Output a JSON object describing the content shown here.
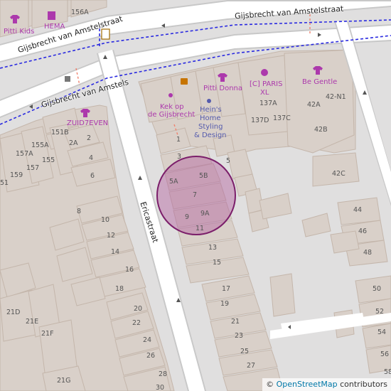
{
  "map": {
    "streets": {
      "gijsbrecht_top_right": "Gijsbrecht van Amstelstraat",
      "gijsbrecht_top_left": "Gijsbrecht van Amstelstraat",
      "gijsbrecht_lower": "Gijsbrecht van Amstels",
      "ericastraat": "Ericastraat"
    },
    "pois": {
      "pitti_kids": "Pitti Kids",
      "hema": "HEMA",
      "zuid7even": "ZUID7EVEN",
      "kek_op_de_gijsbrecht_1": "Kek op",
      "kek_op_de_gijsbrecht_2": "de Gijsbrecht",
      "pitti_donna": "Pitti Donna",
      "heins_1": "Hein's",
      "heins_2": "Home",
      "heins_3": "Styling",
      "heins_4": "& Design",
      "c_paris_1": "[C] PARIS",
      "c_paris_2": "XL",
      "be_gentle": "Be Gentle"
    },
    "house_numbers": {
      "n156A": "156A",
      "n151B": "151B",
      "n2A": "2A",
      "n2": "2",
      "n157A": "157A",
      "n155A": "155A",
      "n159": "159",
      "n157": "157",
      "n155": "155",
      "n4": "4",
      "n6": "6",
      "n51": "51",
      "n1": "1",
      "n3": "3",
      "n5": "5",
      "n5A": "5A",
      "n5B": "5B",
      "n7": "7",
      "n9": "9",
      "n9A": "9A",
      "n11": "11",
      "n13": "13",
      "n15": "15",
      "n17": "17",
      "n19": "19",
      "n21": "21",
      "n23": "23",
      "n25": "25",
      "n27": "27",
      "n8": "8",
      "n10": "10",
      "n12": "12",
      "n14": "14",
      "n16": "16",
      "n18": "18",
      "n20": "20",
      "n22": "22",
      "n24": "24",
      "n26": "26",
      "n28": "28",
      "n30": "30",
      "n21D": "21D",
      "n21E": "21E",
      "n21F": "21F",
      "n21G": "21G",
      "n137A": "137A",
      "n137D": "137D",
      "n137C": "137C",
      "n42A": "42A",
      "n42N1": "42-N1",
      "n42B": "42B",
      "n42C": "42C",
      "n44": "44",
      "n46": "46",
      "n48": "48",
      "n50": "50",
      "n52": "52",
      "n54": "54",
      "n56": "56",
      "n58": "58"
    },
    "colors": {
      "background": "#e0dfdf",
      "building": "#d9d0c9",
      "building_outline": "#c4b6ab",
      "road": "#ffffff",
      "road_casing": "#c8c8c8",
      "bus_route": "#2a2ae0",
      "poi_magenta": "#ac39ac",
      "cafe_orange": "#c77400",
      "marker_fill": "#b4629f",
      "marker_stroke": "#7b1e6a"
    },
    "attribution": {
      "symbol": "©",
      "link": "OpenStreetMap",
      "suffix": " contributors"
    }
  }
}
